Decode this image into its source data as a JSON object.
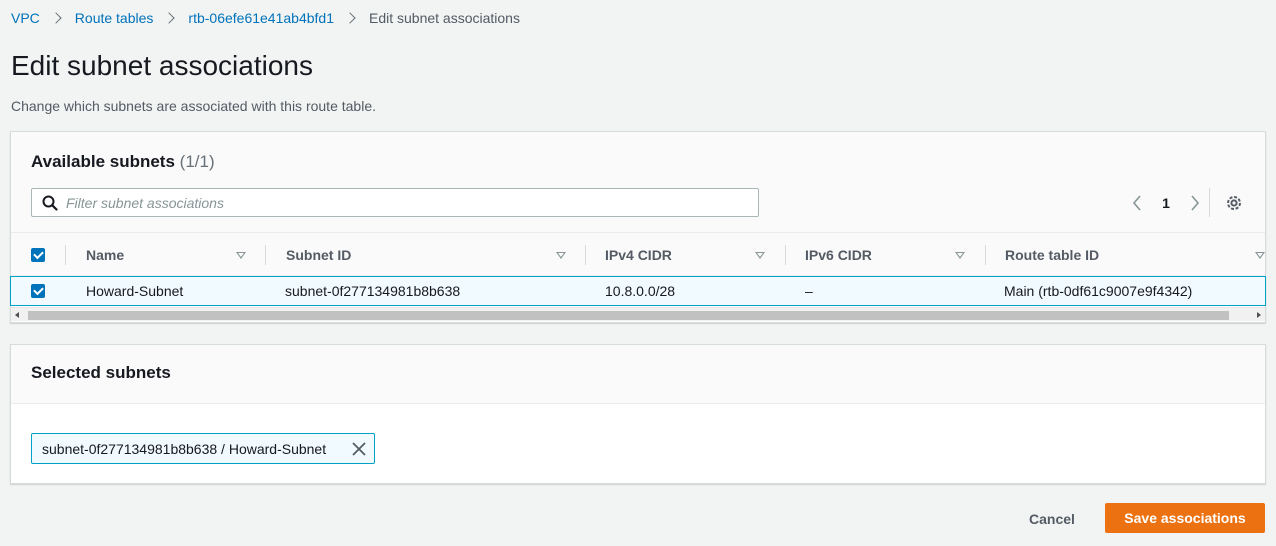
{
  "breadcrumb": {
    "items": [
      {
        "label": "VPC"
      },
      {
        "label": "Route tables"
      },
      {
        "label": "rtb-06efe61e41ab4bfd1"
      },
      {
        "label": "Edit subnet associations"
      }
    ]
  },
  "page": {
    "title": "Edit subnet associations",
    "description": "Change which subnets are associated with this route table."
  },
  "available": {
    "title": "Available subnets",
    "count": "(1/1)",
    "filter_placeholder": "Filter subnet associations",
    "page_number": "1",
    "columns": [
      "Name",
      "Subnet ID",
      "IPv4 CIDR",
      "IPv6 CIDR",
      "Route table ID"
    ],
    "rows": [
      {
        "selected": true,
        "name": "Howard-Subnet",
        "subnet_id": "subnet-0f277134981b8b638",
        "ipv4": "10.8.0.0/28",
        "ipv6": "–",
        "route_table": "Main (rtb-0df61c9007e9f4342)"
      }
    ]
  },
  "selected": {
    "title": "Selected subnets",
    "tokens": [
      {
        "label": "subnet-0f277134981b8b638 / Howard-Subnet"
      }
    ]
  },
  "actions": {
    "cancel": "Cancel",
    "save": "Save associations"
  },
  "colors": {
    "link": "#0073bb",
    "primary_button": "#ec7211",
    "selection_border": "#00a1c9",
    "selection_bg": "#f1faff"
  }
}
